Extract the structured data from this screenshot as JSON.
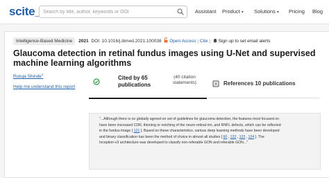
{
  "header": {
    "logo": "scite_",
    "search_placeholder": "Search by title, author, keywords or DOI",
    "nav": [
      {
        "label": "Assistant",
        "has_dropdown": false
      },
      {
        "label": "Product",
        "has_dropdown": true
      },
      {
        "label": "Solutions",
        "has_dropdown": true
      },
      {
        "label": "Pricing",
        "has_dropdown": false
      },
      {
        "label": "Blog",
        "has_dropdown": false
      }
    ],
    "dropdown_glyph": "▾"
  },
  "paper": {
    "category": "Intelligence-Based Medicine",
    "year": "2021",
    "doi": "DOI: 10.1016/j.ibmed.2021.100038",
    "open_access_label": "Open Access",
    "cite_label": "Cite",
    "alert_label": "Sign up to set email alerts",
    "separator": "|",
    "title": "Glaucoma detection in retinal fundus images using U-Net and supervised machine learning algorithms",
    "author": "Rutuja Shinde",
    "author_sup": "1",
    "help_link": "Help me understand this report"
  },
  "tabs": {
    "cited_by_label": "Cited by 65 publications",
    "cited_by_sub": "(40 citation statements)",
    "references_label": "References 10 publications"
  },
  "citation_snippet": {
    "parts": [
      {
        "text": "\"...Although there is no globally agreed-on set of guidelines for glaucoma detection, the features most focused on have been increased CDR, thinning or notching of the neuro-retinal rim, and RNFL defects, which can be reflected in the fundus image [ ",
        "link": false
      },
      {
        "text": "121",
        "link": true
      },
      {
        "text": " ]. Based on these characteristics, various deep learning methods have been developed and binary classification has been the method of choice in almost all studies [ ",
        "link": false
      },
      {
        "text": "60",
        "link": true
      },
      {
        "text": " , ",
        "link": false
      },
      {
        "text": "122",
        "link": true
      },
      {
        "text": " , ",
        "link": false
      },
      {
        "text": "123",
        "link": true
      },
      {
        "text": " , ",
        "link": false
      },
      {
        "text": "124",
        "link": true
      },
      {
        "text": " ]. The Inception-v3 architecture was developed to classify non-referable GON and referable GON...\"",
        "link": false
      }
    ]
  },
  "colors": {
    "brand": "#1f5fa8",
    "supporting_icon": "#2e9b48",
    "tab_active_border": "#1d1d1d"
  },
  "icons": [
    "search-icon",
    "open-access-icon",
    "bell-icon",
    "supporting-citations-icon",
    "references-icon",
    "chevron-down-icon"
  ]
}
